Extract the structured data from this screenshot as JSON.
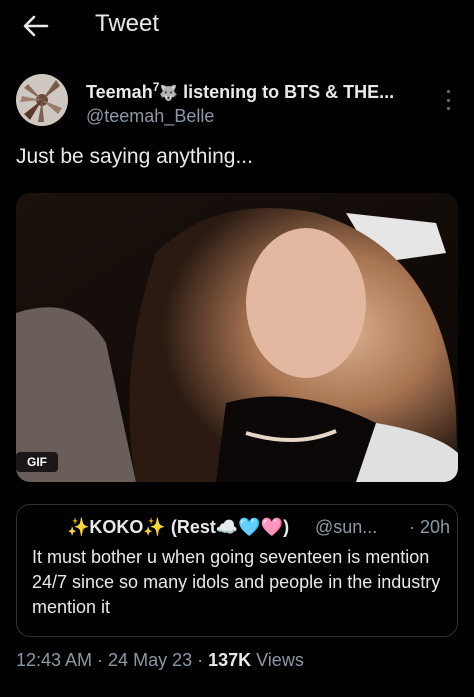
{
  "header": {
    "title": "Tweet",
    "back_icon": "back-arrow-icon"
  },
  "author": {
    "display_name": "Teemah",
    "superscript": "7",
    "emoji": "🐺",
    "name_suffix": "listening to BTS & THE...",
    "handle": "@teemah_Belle",
    "more_icon": "more-vertical-icon"
  },
  "tweet": {
    "text": "Just be saying anything..."
  },
  "media": {
    "badge": "GIF"
  },
  "quote": {
    "name": "✨KOKO✨ (Rest☁️🩵🩷)",
    "handle": "@sun...",
    "time": "· 20h",
    "text": "It must bother u when going seventeen is mention 24/7 since so many idols and people in the industry mention it"
  },
  "meta": {
    "time_date": "12:43 AM · 24 May 23 · ",
    "views_count": "137K",
    "views_label": " Views"
  }
}
